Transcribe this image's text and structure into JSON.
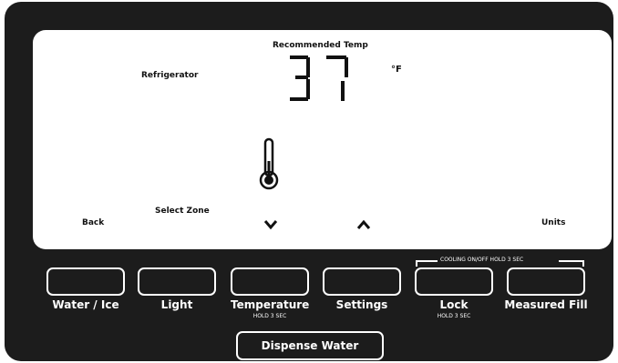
{
  "display": {
    "recommended_label": "Recommended Temp",
    "zone_label": "Refrigerator",
    "temperature": "37",
    "unit": "°F",
    "select_zone": "Select Zone",
    "back": "Back",
    "units": "Units"
  },
  "buttons": [
    {
      "label": "Water / Ice",
      "sub": ""
    },
    {
      "label": "Light",
      "sub": ""
    },
    {
      "label": "Temperature",
      "sub": "HOLD 3 SEC"
    },
    {
      "label": "Settings",
      "sub": ""
    },
    {
      "label": "Lock",
      "sub": "HOLD 3 SEC"
    },
    {
      "label": "Measured Fill",
      "sub": ""
    }
  ],
  "cooling_label": "COOLING ON/OFF HOLD 3 SEC",
  "dispense": "Dispense Water",
  "icons": [
    "thermometer-icon",
    "chevron-down-icon",
    "chevron-up-icon"
  ],
  "colors": {
    "panel": "#1c1c1c",
    "lcd": "#ffffff",
    "text": "#111111"
  }
}
